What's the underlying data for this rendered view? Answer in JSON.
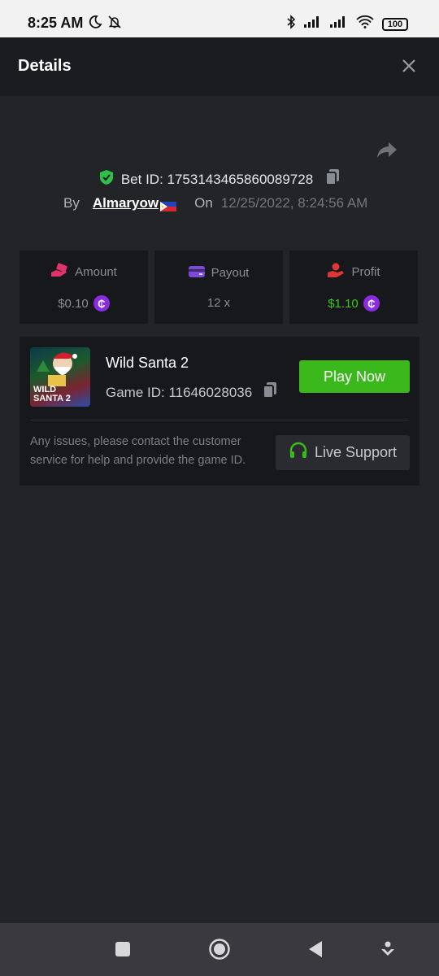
{
  "status_bar": {
    "time": "8:25 AM",
    "battery": "100",
    "icons": [
      "moon-icon",
      "bell-off-icon",
      "bluetooth-icon",
      "signal-icon",
      "signal-icon",
      "wifi-icon",
      "battery-icon"
    ]
  },
  "header": {
    "title": "Details"
  },
  "bet": {
    "id_label": "Bet ID: 1753143465860089728",
    "by_label": "By",
    "username": "Almaryow",
    "on_label": "On",
    "datetime": "12/25/2022, 8:24:56 AM"
  },
  "stats": {
    "amount": {
      "label": "Amount",
      "value": "$0.10",
      "icon_color": "#e0336b"
    },
    "payout": {
      "label": "Payout",
      "value": "12 x",
      "icon_color": "#7b4bd6"
    },
    "profit": {
      "label": "Profit",
      "value": "$1.10",
      "value_color": "#3cc516",
      "icon_color": "#e03535"
    }
  },
  "game": {
    "name": "Wild Santa 2",
    "id_label": "Game ID: 11646028036",
    "thumb_text_1": "WILD",
    "thumb_text_2": "SANTA 2",
    "play_label": "Play Now",
    "issues_text": "Any issues, please contact the customer service for help and provide the game ID.",
    "support_label": "Live Support"
  },
  "colors": {
    "accent_green": "#3ab81c",
    "coin_purple": "#8a2be2",
    "background": "#232428"
  }
}
